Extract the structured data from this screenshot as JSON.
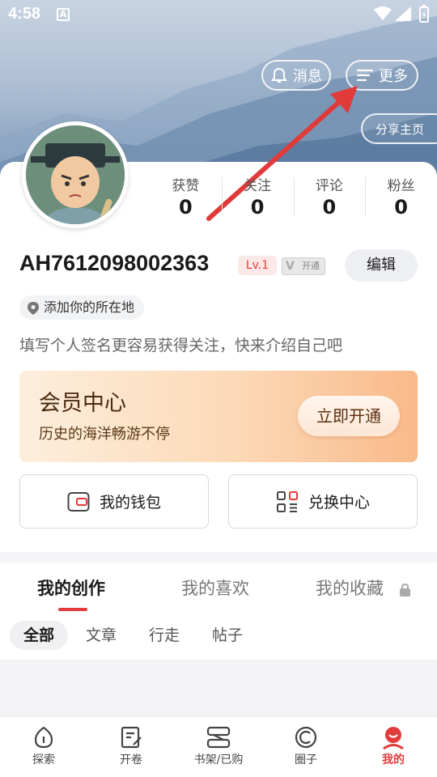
{
  "status_bar": {
    "time": "4:58",
    "notification_icon": "A"
  },
  "header": {
    "message_label": "消息",
    "more_label": "更多",
    "share_label": "分享主页"
  },
  "stats": [
    {
      "label": "获赞",
      "value": "0"
    },
    {
      "label": "关注",
      "value": "0"
    },
    {
      "label": "评论",
      "value": "0"
    },
    {
      "label": "粉丝",
      "value": "0"
    }
  ],
  "profile": {
    "username": "AH7612098002363",
    "level": "Lv.1",
    "vip_badge": "开通",
    "edit_label": "编辑",
    "location": "添加你的所在地",
    "signature": "填写个人签名更容易获得关注，快来介绍自己吧"
  },
  "vip_card": {
    "title": "会员中心",
    "subtitle": "历史的海洋畅游不停",
    "button": "立即开通"
  },
  "actions": {
    "wallet": "我的钱包",
    "exchange": "兑换中心"
  },
  "tabs": [
    {
      "label": "我的创作",
      "active": true
    },
    {
      "label": "我的喜欢",
      "active": false
    },
    {
      "label": "我的收藏",
      "active": false,
      "locked": true
    }
  ],
  "subtabs": [
    "全部",
    "文章",
    "行走",
    "帖子"
  ],
  "bottom_nav": [
    {
      "label": "探索",
      "icon": "explore-icon"
    },
    {
      "label": "开卷",
      "icon": "edit-book-icon"
    },
    {
      "label": "书架/已购",
      "icon": "bookshelf-icon"
    },
    {
      "label": "圈子",
      "icon": "circle-icon"
    },
    {
      "label": "我的",
      "icon": "profile-icon",
      "active": true
    }
  ],
  "colors": {
    "accent": "#e23b3b",
    "vip_gold": "#f9b98a"
  }
}
